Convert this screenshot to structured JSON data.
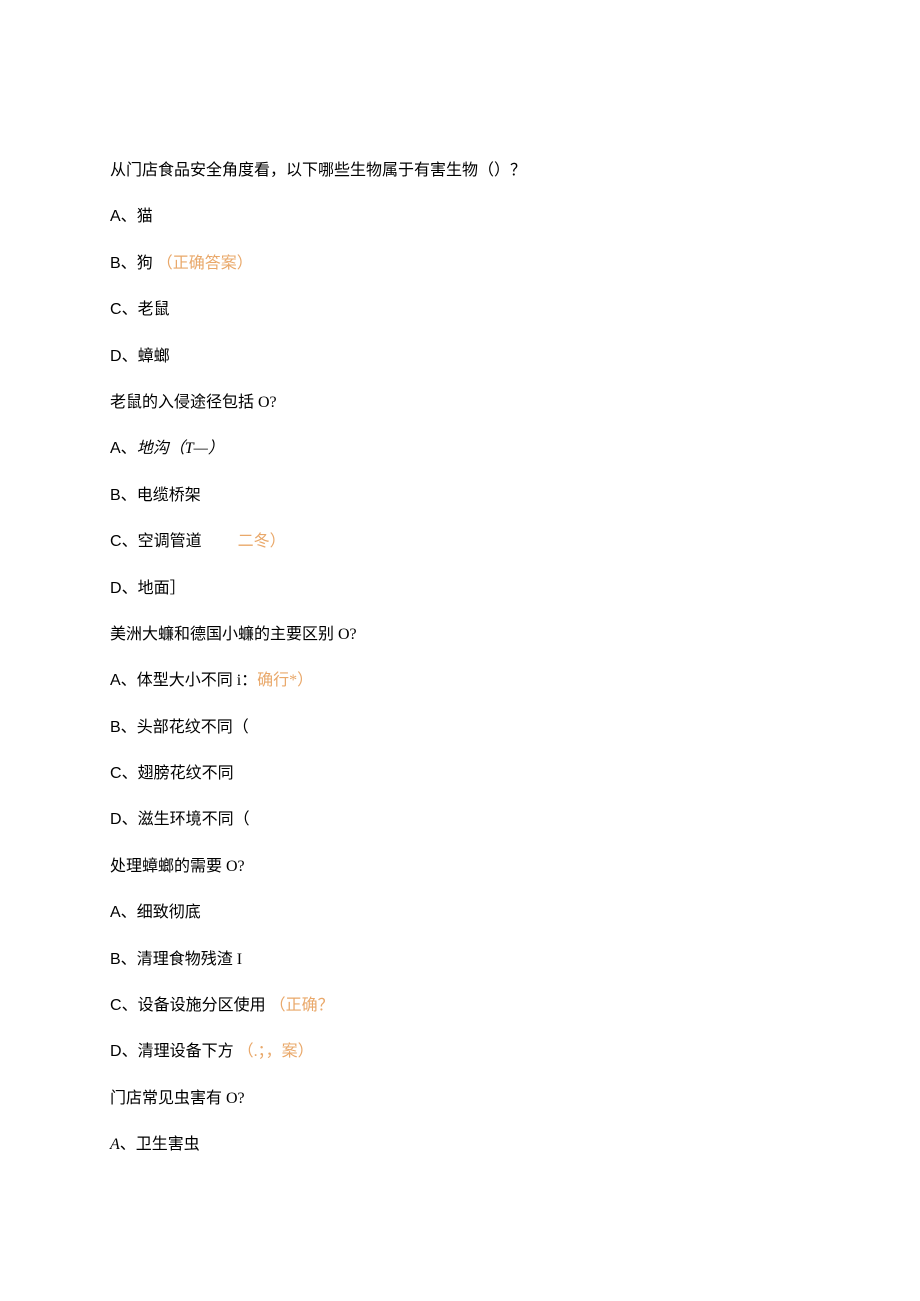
{
  "q1": {
    "text": "从门店食品安全角度看，以下哪些生物属于有害生物（）？",
    "a_letter": "A",
    "a_text": "猫",
    "b_letter": "B",
    "b_text": "狗",
    "b_note": "（正确答案）",
    "c_letter": "C",
    "c_text": "老鼠",
    "d_letter": "D",
    "d_text": "蟑螂"
  },
  "q2": {
    "text": "老鼠的入侵途径包括 O?",
    "a_letter": "A",
    "a_text": "地沟（T—）",
    "b_letter": "B",
    "b_text": "电缆桥架",
    "c_letter": "C",
    "c_text": "空调管道",
    "c_note": "二冬）",
    "d_letter": "D",
    "d_text": "地面］"
  },
  "q3": {
    "text": "美洲大蠊和德国小蠊的主要区别 O?",
    "a_letter": "A",
    "a_text": "体型大小不同 i：",
    "a_note": "确行*）",
    "b_letter": "B",
    "b_text": "头部花纹不同（",
    "c_letter": "C",
    "c_text": "翅膀花纹不同",
    "d_letter": "D",
    "d_text": "滋生环境不同（"
  },
  "q4": {
    "text": "处理蟑螂的需要 O?",
    "a_letter": "A",
    "a_text": "细致彻底",
    "b_letter": "B",
    "b_text": "清理食物残渣 I",
    "c_letter": "C",
    "c_text": "设备设施分区使用",
    "c_note": "（正确？",
    "d_letter": "D",
    "d_text": "清理设备下方",
    "d_note": "（.；，案）"
  },
  "q5": {
    "text": "门店常见虫害有 O?",
    "a_letter": "A",
    "a_text": "卫生害虫"
  },
  "sep": "、"
}
